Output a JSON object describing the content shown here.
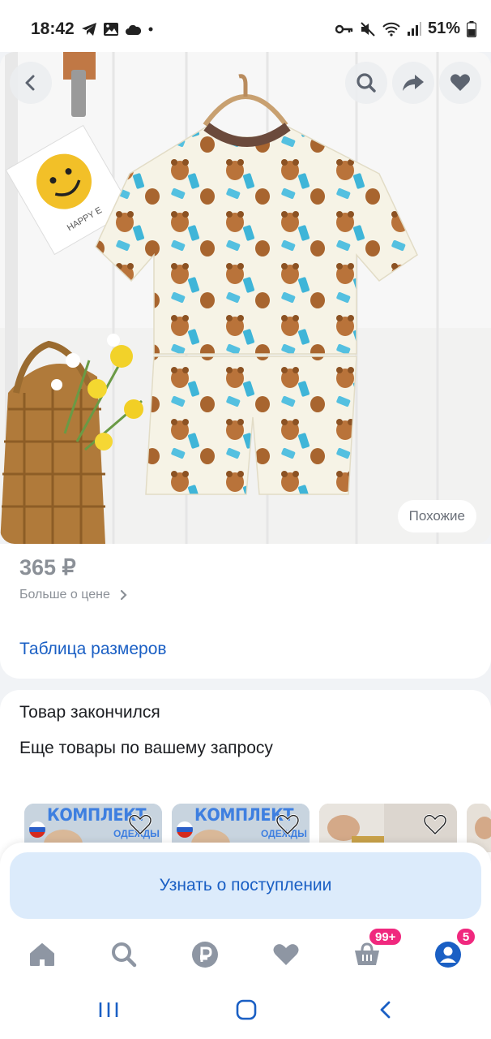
{
  "status_bar": {
    "time": "18:42",
    "battery": "51%",
    "icons": [
      "telegram-icon",
      "gallery-icon",
      "cloud-icon",
      "dot-icon",
      "key-icon",
      "mute-icon",
      "wifi-icon",
      "signal-icon",
      "battery-icon"
    ]
  },
  "hero": {
    "toolbar_icons": [
      "back-icon",
      "search-icon",
      "share-icon",
      "heart-icon"
    ],
    "tag_text": "HAPPY E",
    "similar_label": "Похожие"
  },
  "price_block": {
    "price": "365 ₽",
    "more_label": "Больше о цене",
    "size_table_label": "Таблица размеров"
  },
  "stock_block": {
    "status_title": "Товар закончился",
    "more_title": "Еще товары по вашему запросу",
    "thumbnails": [
      {
        "banner": "КОМПЛЕКТ",
        "sub": "ОДЕЖДЫ"
      },
      {
        "banner": "КОМПЛЕКТ",
        "sub": "ОДЕЖДЫ"
      },
      {
        "banner": "",
        "sub": ""
      },
      {
        "banner": "",
        "sub": ""
      }
    ]
  },
  "notify": {
    "label": "Узнать о поступлении"
  },
  "bottom_nav": {
    "items": [
      "home-icon",
      "search-icon",
      "ruble-icon",
      "favorites-icon",
      "cart-icon",
      "profile-icon"
    ],
    "cart_badge": "99+",
    "profile_badge": "5"
  },
  "colors": {
    "accent_blue": "#1a5fc4",
    "nav_icon": "#8e96a3",
    "badge_pink": "#f0287e",
    "notify_bg": "#dcebfb"
  }
}
